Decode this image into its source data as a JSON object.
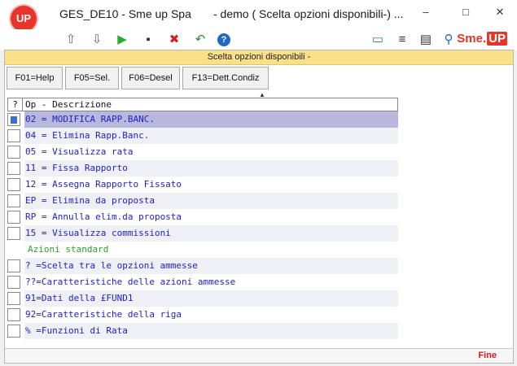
{
  "window": {
    "app_title": "GES_DE10 - Sme up Spa",
    "doc_title": "- demo ( Scelta opzioni disponibili-) ...",
    "logo_text": "UP",
    "minimize": "–",
    "maximize": "□",
    "close": "✕"
  },
  "toolbar": {
    "up_icon": "⇧",
    "down_icon": "⇩",
    "run_icon": "▶",
    "terminal_icon": "▪",
    "delete_icon": "✖",
    "undo_icon": "↶",
    "help_icon": "?",
    "monitor_icon": "▭",
    "list_icon": "≡",
    "doc_icon": "▤",
    "search_icon": "⚲",
    "brand": "Sme.",
    "brand_up": "UP"
  },
  "header": {
    "title": "Scelta opzioni disponibili -"
  },
  "fkeys": [
    "F01=Help",
    "F05=Sel.",
    "F06=Desel",
    "F13=Dett.Condiz"
  ],
  "grid": {
    "col_q": "?",
    "col_desc": "Op - Descrizione",
    "rows": [
      {
        "text": "02 = MODIFICA RAPP.BANC.",
        "type": "option"
      },
      {
        "text": "04 = Elimina Rapp.Banc.",
        "type": "option"
      },
      {
        "text": "05 = Visualizza rata",
        "type": "option"
      },
      {
        "text": "11 = Fissa Rapporto",
        "type": "option"
      },
      {
        "text": "12 = Assegna Rapporto Fissato",
        "type": "option"
      },
      {
        "text": "EP = Elimina da proposta",
        "type": "option"
      },
      {
        "text": "RP = Annulla elim.da proposta",
        "type": "option"
      },
      {
        "text": "15 = Visualizza commissioni",
        "type": "option"
      },
      {
        "text": "Azioni standard",
        "type": "group"
      },
      {
        "text": "? =Scelta tra le opzioni ammesse",
        "type": "option"
      },
      {
        "text": "??=Caratteristiche delle azioni ammesse",
        "type": "option"
      },
      {
        "text": "91=Dati della £FUND1",
        "type": "option"
      },
      {
        "text": "92=Caratteristiche della riga",
        "type": "option"
      },
      {
        "text": "% =Funzioni di Rata",
        "type": "option"
      }
    ]
  },
  "status": {
    "text": "Fine"
  },
  "colors": {
    "accent": "#e8342a",
    "header": "#fbe08a",
    "selection": "#b8b8dc",
    "option_text": "#1e1ec8",
    "group_text": "#2e9d2e"
  }
}
